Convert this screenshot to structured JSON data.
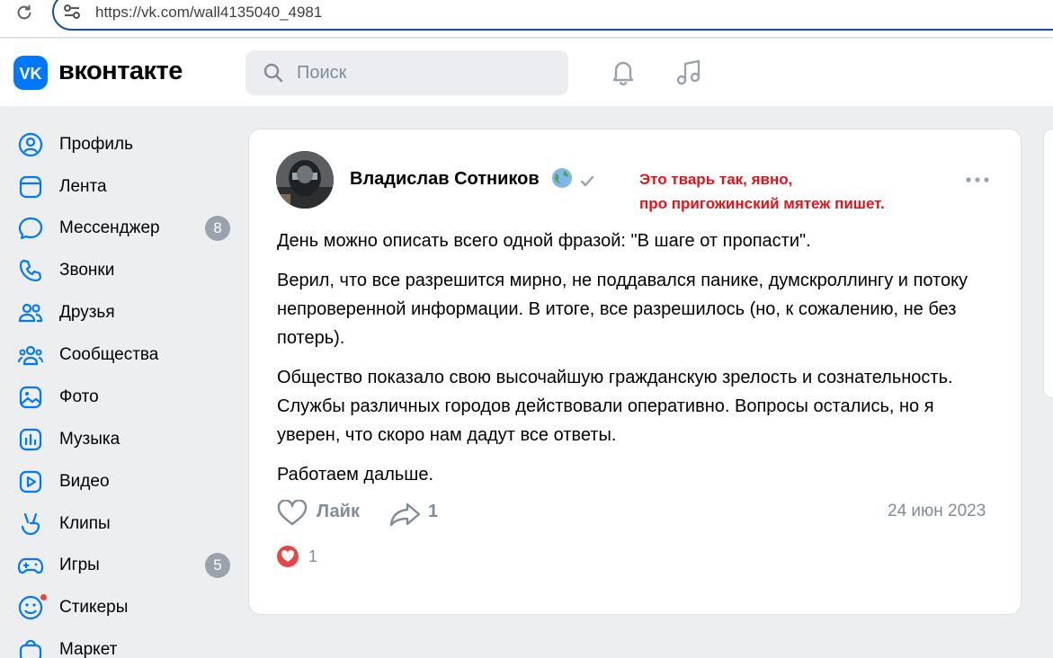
{
  "browser": {
    "url": "https://vk.com/wall4135040_4981"
  },
  "header": {
    "logo_text": "вконтакте",
    "search_placeholder": "Поиск"
  },
  "sidebar": {
    "items": [
      {
        "label": "Профиль",
        "icon": "profile-icon"
      },
      {
        "label": "Лента",
        "icon": "feed-icon"
      },
      {
        "label": "Мессенджер",
        "icon": "messenger-icon",
        "badge": "8"
      },
      {
        "label": "Звонки",
        "icon": "phone-icon"
      },
      {
        "label": "Друзья",
        "icon": "friends-icon"
      },
      {
        "label": "Сообщества",
        "icon": "communities-icon"
      },
      {
        "label": "Фото",
        "icon": "photo-icon"
      },
      {
        "label": "Музыка",
        "icon": "music-icon"
      },
      {
        "label": "Видео",
        "icon": "video-icon"
      },
      {
        "label": "Клипы",
        "icon": "clips-icon"
      },
      {
        "label": "Игры",
        "icon": "games-icon",
        "badge": "5"
      },
      {
        "label": "Стикеры",
        "icon": "stickers-icon"
      },
      {
        "label": "Маркет",
        "icon": "market-icon"
      }
    ]
  },
  "post": {
    "author": "Владислав Сотников",
    "annotation_line1": "Это тварь так, явно,",
    "annotation_line2": "про пригожинский мятеж пишет.",
    "paragraphs": [
      "День можно описать всего одной фразой: \"В шаге от пропасти\".",
      "Верил, что все разрешится мирно, не поддавался панике, думскроллингу и потоку непроверенной информации. В итоге, все разрешилось (но, к сожалению, не без потерь).",
      "Общество показало свою высочайшую гражданскую зрелость и сознательность. Службы различных городов действовали оперативно. Вопросы остались, но я уверен, что скоро нам дадут все ответы.",
      "Работаем дальше."
    ],
    "like_label": "Лайк",
    "share_count": "1",
    "date": "24 июн 2023",
    "reaction_count": "1"
  },
  "colors": {
    "accent": "#0077ff",
    "annotation": "#e2141b",
    "muted": "#818c99",
    "reaction": "#e64646"
  }
}
